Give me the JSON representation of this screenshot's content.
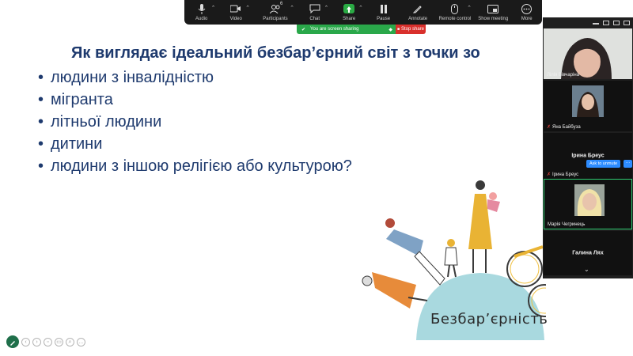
{
  "toolbar": {
    "audio": "Audio",
    "video": "Video",
    "participants": "Participants",
    "participants_count": "6",
    "chat": "Chat",
    "share": "Share",
    "pause": "Pause",
    "annotate": "Annotate",
    "remote_control": "Remote control",
    "show_meeting": "Show meeting",
    "more": "More"
  },
  "sharing": {
    "status": "You are screen sharing",
    "stop": "Stop share",
    "status_color": "#2aa84a",
    "stop_color": "#d9302c"
  },
  "slide": {
    "title": "Як виглядає ідеальний безбар’єрний світ з точки зо",
    "bullets": [
      "людини з інвалідністю",
      "мігранта",
      "літньої людини",
      "дитини",
      "людини з іншою релігією або культурою?"
    ],
    "logo_text": "Безбар’єрність",
    "text_color": "#1e3a6e"
  },
  "panel": {
    "participants": [
      {
        "name": "Лілія Вівчаріна",
        "muted": false
      },
      {
        "name": "Яна Байбуза",
        "muted": true
      },
      {
        "name": "Ірина Бреус",
        "muted": false
      },
      {
        "name": "Ірина Бреус",
        "muted": true
      },
      {
        "name": "Марія Чегринець",
        "muted": false
      },
      {
        "name": "Галина Лях",
        "muted": false
      }
    ],
    "ask_to_unmute": "Ask to unmute",
    "more": "···"
  }
}
